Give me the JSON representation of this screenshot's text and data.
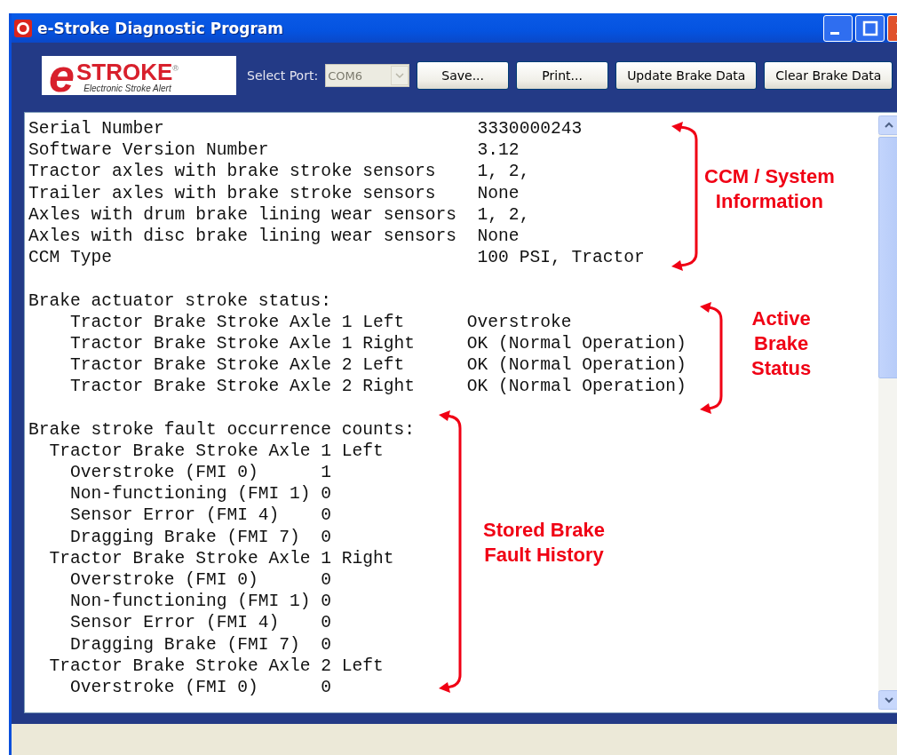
{
  "window": {
    "title": "e-Stroke Diagnostic Program"
  },
  "toolbar": {
    "logo": {
      "letter": "e",
      "brand": "STROKE$^{®}$",
      "tagline": "Electronic Stroke Alert"
    },
    "port_label": "Select Port:",
    "port": {
      "value": "COM6",
      "disabled": true
    },
    "buttons": [
      "Save...",
      "Print...",
      "Update Brake Data",
      "Clear Brake Data"
    ]
  },
  "report": {
    "sections": [
      {
        "kind": "info",
        "rows": [
          {
            "label": "Serial Number",
            "value": "3330000243"
          },
          {
            "label": "Software Version Number",
            "value": "3.12"
          },
          {
            "label": "Tractor axles with brake stroke sensors",
            "value": "1, 2,"
          },
          {
            "label": "Trailer axles with brake stroke sensors",
            "value": "None"
          },
          {
            "label": "Axles with drum brake lining wear sensors",
            "value": "1, 2,"
          },
          {
            "label": "Axles with disc brake lining wear sensors",
            "value": "None"
          },
          {
            "label": "CCM Type",
            "value": "100 PSI, Tractor"
          }
        ]
      },
      {
        "kind": "status",
        "title": "Brake actuator stroke status:",
        "rows": [
          {
            "label": "Tractor Brake Stroke Axle 1 Left",
            "value": "Overstroke"
          },
          {
            "label": "Tractor Brake Stroke Axle 1 Right",
            "value": "OK (Normal Operation)"
          },
          {
            "label": "Tractor Brake Stroke Axle 2 Left",
            "value": "OK (Normal Operation)"
          },
          {
            "label": "Tractor Brake Stroke Axle 2 Right",
            "value": "OK (Normal Operation)"
          }
        ]
      },
      {
        "kind": "faults",
        "title": "Brake stroke fault occurrence counts:",
        "groups": [
          {
            "title": "Tractor Brake Stroke Axle 1 Left",
            "children": [
              {
                "label": "Overstroke (FMI 0)",
                "value": "1"
              },
              {
                "label": "Non-functioning (FMI 1)",
                "value": "0"
              },
              {
                "label": "Sensor Error (FMI 4)",
                "value": "0"
              },
              {
                "label": "Dragging Brake (FMI 7)",
                "value": "0"
              }
            ]
          },
          {
            "title": "Tractor Brake Stroke Axle 1 Right",
            "children": [
              {
                "label": "Overstroke (FMI 0)",
                "value": "0"
              },
              {
                "label": "Non-functioning (FMI 1)",
                "value": "0"
              },
              {
                "label": "Sensor Error (FMI 4)",
                "value": "0"
              },
              {
                "label": "Dragging Brake (FMI 7)",
                "value": "0"
              }
            ]
          },
          {
            "title": "Tractor Brake Stroke Axle 2 Left",
            "children": [
              {
                "label": "Overstroke (FMI 0)",
                "value": "0"
              }
            ]
          }
        ]
      }
    ]
  },
  "annotations": [
    {
      "lines": [
        "CCM / System",
        "Information"
      ]
    },
    {
      "lines": [
        "Active",
        "Brake",
        "Status"
      ]
    },
    {
      "lines": [
        "Stored Brake",
        "Fault History"
      ]
    }
  ]
}
